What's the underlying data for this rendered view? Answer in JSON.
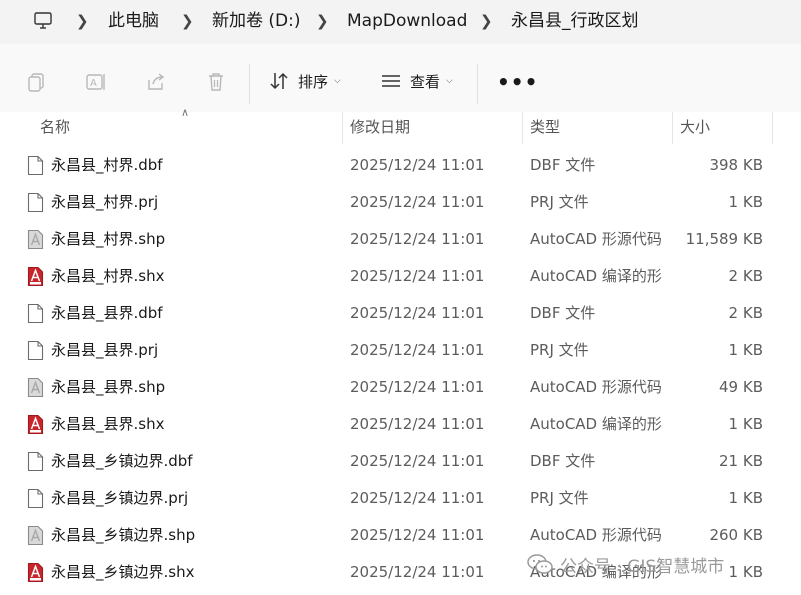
{
  "breadcrumb": {
    "items": [
      "此电脑",
      "新加卷 (D:)",
      "MapDownload",
      "永昌县_行政区划"
    ]
  },
  "toolbar": {
    "sort_label": "排序",
    "view_label": "查看",
    "more_label": "•••"
  },
  "columns": {
    "name": "名称",
    "date": "修改日期",
    "type": "类型",
    "size": "大小"
  },
  "files": [
    {
      "name": "永昌县_村界.dbf",
      "date": "2025/12/24 11:01",
      "type": "DBF 文件",
      "size": "398 KB",
      "icon": "blank-file-icon"
    },
    {
      "name": "永昌县_村界.prj",
      "date": "2025/12/24 11:01",
      "type": "PRJ 文件",
      "size": "1 KB",
      "icon": "blank-file-icon"
    },
    {
      "name": "永昌县_村界.shp",
      "date": "2025/12/24 11:01",
      "type": "AutoCAD 形源代码",
      "size": "11,589 KB",
      "icon": "shp-file-icon"
    },
    {
      "name": "永昌县_村界.shx",
      "date": "2025/12/24 11:01",
      "type": "AutoCAD 编译的形",
      "size": "2 KB",
      "icon": "shx-file-icon"
    },
    {
      "name": "永昌县_县界.dbf",
      "date": "2025/12/24 11:01",
      "type": "DBF 文件",
      "size": "2 KB",
      "icon": "blank-file-icon"
    },
    {
      "name": "永昌县_县界.prj",
      "date": "2025/12/24 11:01",
      "type": "PRJ 文件",
      "size": "1 KB",
      "icon": "blank-file-icon"
    },
    {
      "name": "永昌县_县界.shp",
      "date": "2025/12/24 11:01",
      "type": "AutoCAD 形源代码",
      "size": "49 KB",
      "icon": "shp-file-icon"
    },
    {
      "name": "永昌县_县界.shx",
      "date": "2025/12/24 11:01",
      "type": "AutoCAD 编译的形",
      "size": "1 KB",
      "icon": "shx-file-icon"
    },
    {
      "name": "永昌县_乡镇边界.dbf",
      "date": "2025/12/24 11:01",
      "type": "DBF 文件",
      "size": "21 KB",
      "icon": "blank-file-icon"
    },
    {
      "name": "永昌县_乡镇边界.prj",
      "date": "2025/12/24 11:01",
      "type": "PRJ 文件",
      "size": "1 KB",
      "icon": "blank-file-icon"
    },
    {
      "name": "永昌县_乡镇边界.shp",
      "date": "2025/12/24 11:01",
      "type": "AutoCAD 形源代码",
      "size": "260 KB",
      "icon": "shp-file-icon"
    },
    {
      "name": "永昌县_乡镇边界.shx",
      "date": "2025/12/24 11:01",
      "type": "AutoCAD 编译的形",
      "size": "1 KB",
      "icon": "shx-file-icon"
    }
  ],
  "watermark": {
    "text": "公众号 · GIS智慧城市"
  },
  "colors": {
    "address_bg": "#f3f3f3",
    "toolbar_bg": "#f9f9f9",
    "shx_red": "#c9252b",
    "secondary_text": "#5c5c5c"
  }
}
